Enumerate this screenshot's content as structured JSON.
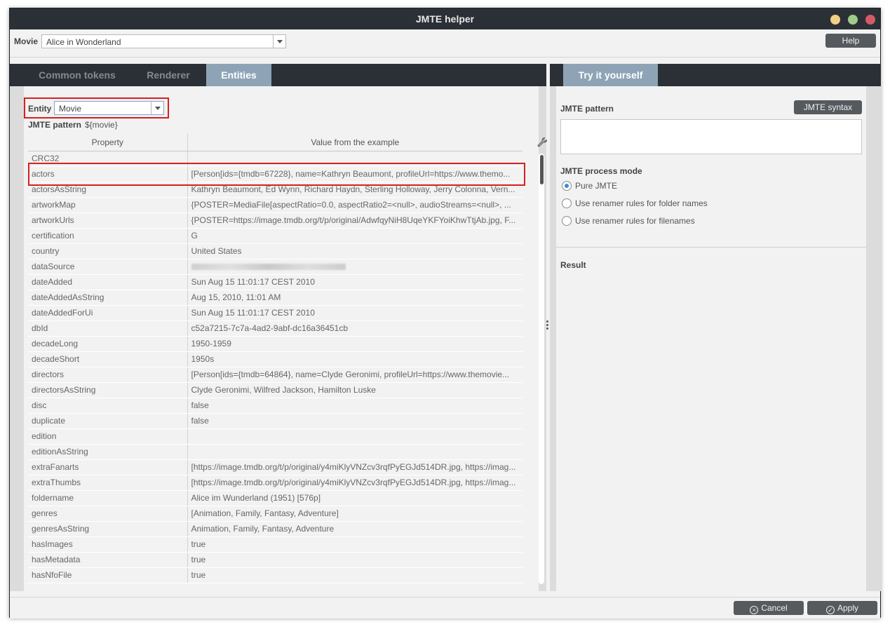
{
  "window": {
    "title": "JMTE helper"
  },
  "topbar": {
    "movie_label": "Movie",
    "movie_value": "Alice in Wonderland",
    "help_label": "Help"
  },
  "left_tabs": [
    {
      "label": "Common tokens",
      "active": false
    },
    {
      "label": "Renderer",
      "active": false
    },
    {
      "label": "Entities",
      "active": true
    }
  ],
  "right_tabs": [
    {
      "label": "Try it yourself",
      "active": true
    }
  ],
  "entities": {
    "entity_label": "Entity",
    "entity_value": "Movie",
    "pattern_label": "JMTE pattern",
    "pattern_value": "${movie}",
    "columns": [
      "Property",
      "Value from the example"
    ],
    "rows": [
      [
        "CRC32",
        ""
      ],
      [
        "actors",
        "[Person[ids={tmdb=67228}, name=Kathryn Beaumont, profileUrl=https://www.themo..."
      ],
      [
        "actorsAsString",
        "Kathryn Beaumont, Ed Wynn, Richard Haydn, Sterling Holloway, Jerry Colonna, Vern..."
      ],
      [
        "artworkMap",
        "{POSTER=MediaFile[aspectRatio=0.0, aspectRatio2=<null>, audioStreams=<null>, ..."
      ],
      [
        "artworkUrls",
        "{POSTER=https://image.tmdb.org/t/p/original/AdwfqyNiH8UqeYKFYoiKhwTtjAb.jpg, F..."
      ],
      [
        "certification",
        "G"
      ],
      [
        "country",
        "United States"
      ],
      [
        "dataSource",
        ""
      ],
      [
        "dateAdded",
        "Sun Aug 15 11:01:17 CEST 2010"
      ],
      [
        "dateAddedAsString",
        "Aug 15, 2010, 11:01 AM"
      ],
      [
        "dateAddedForUi",
        "Sun Aug 15 11:01:17 CEST 2010"
      ],
      [
        "dbId",
        "c52a7215-7c7a-4ad2-9abf-dc16a36451cb"
      ],
      [
        "decadeLong",
        "1950-1959"
      ],
      [
        "decadeShort",
        "1950s"
      ],
      [
        "directors",
        "[Person[ids={tmdb=64864}, name=Clyde Geronimi, profileUrl=https://www.themovie..."
      ],
      [
        "directorsAsString",
        "Clyde Geronimi, Wilfred Jackson, Hamilton Luske"
      ],
      [
        "disc",
        "false"
      ],
      [
        "duplicate",
        "false"
      ],
      [
        "edition",
        ""
      ],
      [
        "editionAsString",
        ""
      ],
      [
        "extraFanarts",
        "[https://image.tmdb.org/t/p/original/y4miKlyVNZcv3rqfPyEGJd514DR.jpg, https://imag..."
      ],
      [
        "extraThumbs",
        "[https://image.tmdb.org/t/p/original/y4miKlyVNZcv3rqfPyEGJd514DR.jpg, https://imag..."
      ],
      [
        "foldername",
        "Alice im Wunderland (1951) [576p]"
      ],
      [
        "genres",
        "[Animation, Family, Fantasy, Adventure]"
      ],
      [
        "genresAsString",
        "Animation, Family, Fantasy, Adventure"
      ],
      [
        "hasImages",
        "true"
      ],
      [
        "hasMetadata",
        "true"
      ],
      [
        "hasNfoFile",
        "true"
      ]
    ]
  },
  "try_it": {
    "pattern_label": "JMTE pattern",
    "syntax_button": "JMTE syntax",
    "pattern_value": "",
    "process_mode_label": "JMTE process mode",
    "modes": [
      {
        "label": "Pure JMTE",
        "selected": true
      },
      {
        "label": "Use renamer rules for folder names",
        "selected": false
      },
      {
        "label": "Use renamer rules for filenames",
        "selected": false
      }
    ],
    "result_label": "Result"
  },
  "bottombar": {
    "cancel_label": "Cancel",
    "apply_label": "Apply"
  },
  "colors": {
    "titlebar": "#2b3036",
    "tab_active": "#8ea4b6",
    "highlight_box": "#d62020",
    "radio_selected": "#3a8ed8"
  }
}
